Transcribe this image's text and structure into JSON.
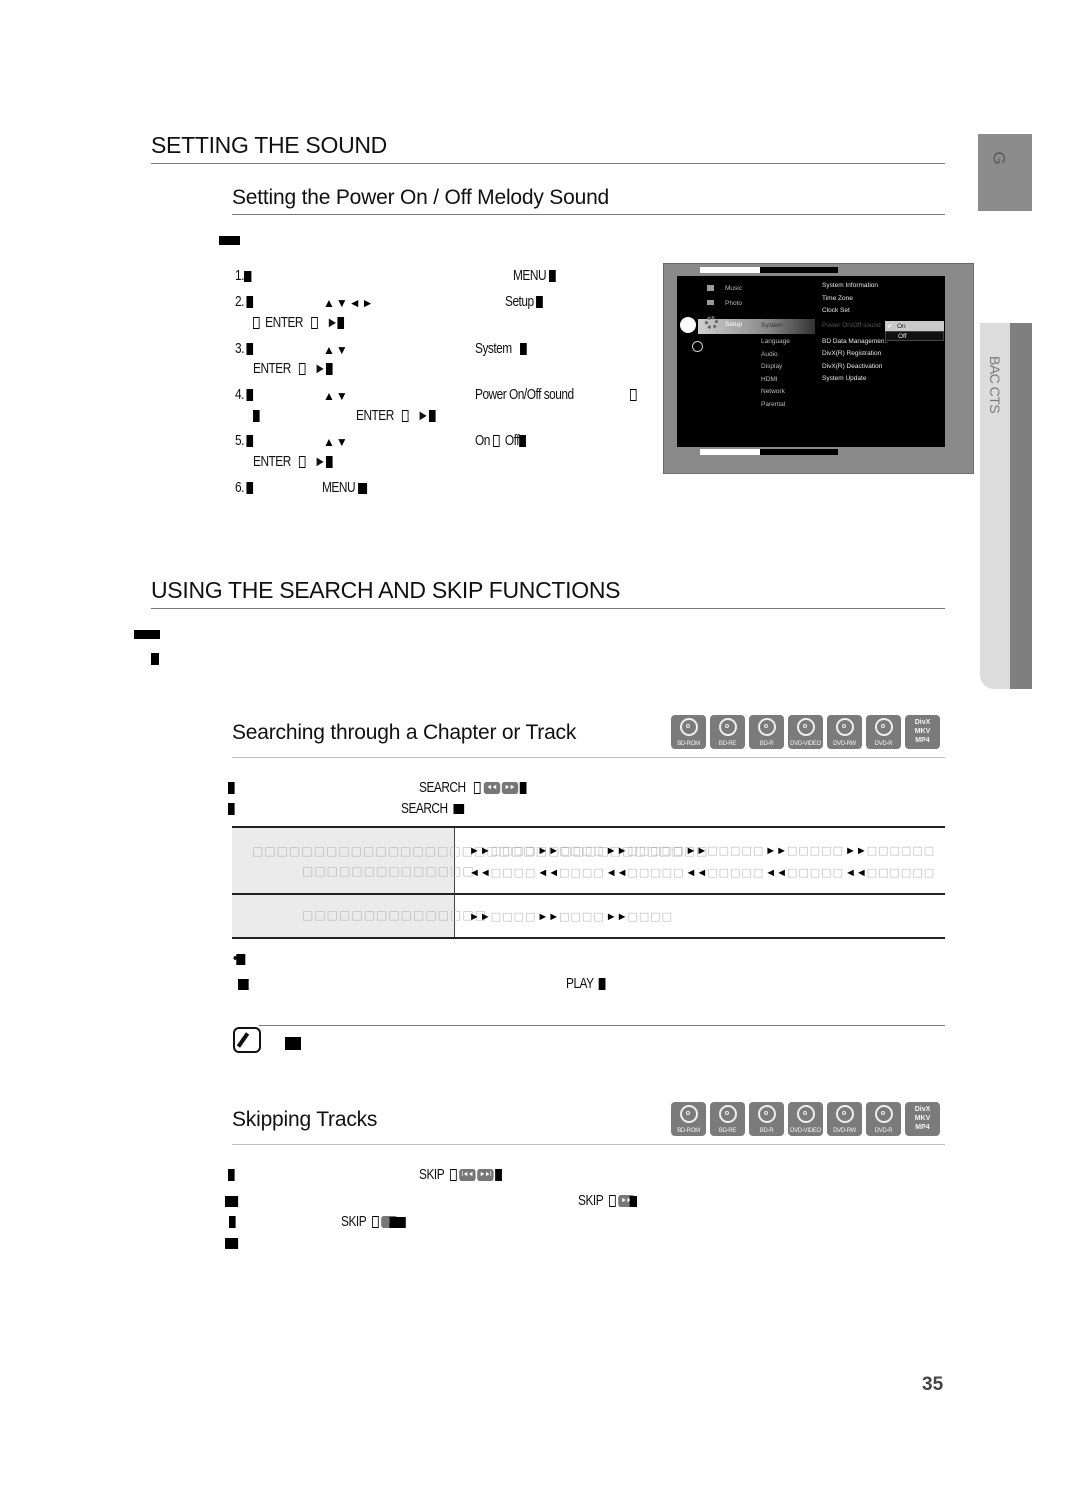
{
  "sections": {
    "setting_sound": {
      "title": "SETTING THE SOUND",
      "subsection_title": "Setting the Power On / Off Melody Sound",
      "steps": [
        {
          "num": "1.",
          "key": "MENU"
        },
        {
          "num": "2.",
          "arrows": "▲▼◄►",
          "target": "Setup",
          "key": "ENTER",
          "alt": "►"
        },
        {
          "num": "3.",
          "arrows": "▲▼",
          "target": "System",
          "key": "ENTER",
          "alt": "►"
        },
        {
          "num": "4.",
          "arrows": "▲▼",
          "target": "Power On/Off sound",
          "key": "ENTER",
          "alt": "►"
        },
        {
          "num": "5.",
          "arrows": "▲▼",
          "target_on": "On",
          "target_off": "Off",
          "key": "ENTER",
          "alt": "►"
        },
        {
          "num": "6.",
          "key": "MENU"
        }
      ]
    },
    "search_skip": {
      "title": "USING THE SEARCH AND SKIP FUNCTIONS"
    },
    "searching": {
      "title": "Searching through a Chapter or Track",
      "search_key_1": "SEARCH",
      "search_key_2": "SEARCH",
      "play_key": "PLAY",
      "fwd": "►►",
      "rew": "◄◄"
    },
    "skipping": {
      "title": "Skipping Tracks",
      "skip_key_1": "SKIP",
      "skip_key_2": "SKIP",
      "skip_key_3": "SKIP"
    }
  },
  "disc_badges": [
    {
      "label": "BD-ROM",
      "type": "bd"
    },
    {
      "label": "BD-RE",
      "type": "bd"
    },
    {
      "label": "BD-R",
      "type": "bd"
    },
    {
      "label": "DVD-VIDEO",
      "type": "dvd"
    },
    {
      "label": "DVD-RW",
      "type": "dvd"
    },
    {
      "label": "DVD-R",
      "type": "dvd"
    },
    {
      "label": "DivX MKV MP4",
      "type": "file",
      "lines": [
        "DivX",
        "MKV",
        "MP4"
      ]
    }
  ],
  "tv_menu": {
    "left": [
      "Music",
      "Photo",
      "Setup"
    ],
    "middle": [
      "System",
      "Language",
      "Audio",
      "Display",
      "HDMI",
      "Network",
      "Parental"
    ],
    "right": [
      "System Information",
      "Time Zone",
      "Clock Set",
      "Power On/Off sound",
      "BD Data Managemen..",
      "DivX(R) Registration",
      "DivX(R) Deactivation",
      "System Update"
    ],
    "popup": {
      "selected": "On",
      "other": "Off",
      "check": "✔"
    }
  },
  "side_tabs": {
    "top_letter": "G",
    "chapter": "BASIC FUNCTIONS",
    "chapter_visible": "BAC CTS"
  },
  "page_number": "35"
}
